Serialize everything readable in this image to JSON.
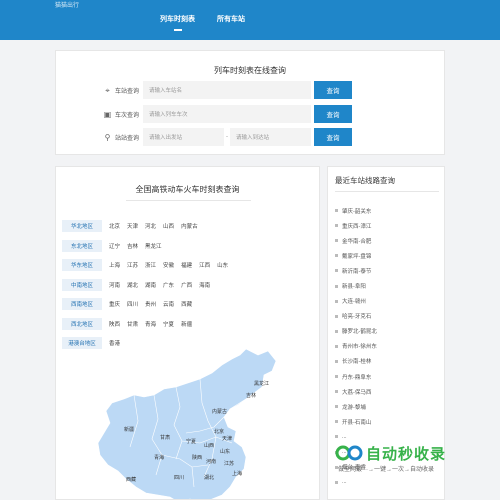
{
  "header": {
    "site_name": "猫猫出行",
    "nav": [
      {
        "label": "列车时刻表",
        "active": true
      },
      {
        "label": "所有车站",
        "active": false
      }
    ]
  },
  "search": {
    "title": "列车时刻表在线查询",
    "station": {
      "label": "车站查询",
      "placeholder": "请输入车站名",
      "button": "查询"
    },
    "train": {
      "label": "车次查询",
      "placeholder": "请输入列车车次",
      "button": "查询"
    },
    "route": {
      "label": "站站查询",
      "from_placeholder": "请输入出发站",
      "separator": "-",
      "to_placeholder": "请输入到达站",
      "button": "查询"
    }
  },
  "regions": {
    "title": "全国高铁动车火车时刻表查询",
    "rows": [
      {
        "name": "华北地区",
        "provinces": [
          "北京",
          "天津",
          "河北",
          "山西",
          "内蒙古"
        ]
      },
      {
        "name": "东北地区",
        "provinces": [
          "辽宁",
          "吉林",
          "黑龙江"
        ]
      },
      {
        "name": "华东地区",
        "provinces": [
          "上海",
          "江苏",
          "浙江",
          "安徽",
          "福建",
          "江西",
          "山东"
        ]
      },
      {
        "name": "中南地区",
        "provinces": [
          "河南",
          "湖北",
          "湖南",
          "广东",
          "广西",
          "海南"
        ]
      },
      {
        "name": "西南地区",
        "provinces": [
          "重庆",
          "四川",
          "贵州",
          "云南",
          "西藏"
        ]
      },
      {
        "name": "西北地区",
        "provinces": [
          "陕西",
          "甘肃",
          "青海",
          "宁夏",
          "新疆"
        ]
      },
      {
        "name": "港澳台地区",
        "provinces": [
          "香港"
        ]
      }
    ],
    "map_labels": {
      "heilongjiang": "黑龙江",
      "jilin": "吉林",
      "neimenggu": "内蒙古",
      "xinjiang": "新疆",
      "gansu": "甘肃",
      "beijing": "北京",
      "tianjin": "天津",
      "ningxia": "宁夏",
      "shanxi": "山西",
      "shandong": "山东",
      "qinghai": "青海",
      "shaanxi": "陕西",
      "henan": "河南",
      "jiangsu": "江苏",
      "shanghai": "上海",
      "xizang": "西藏",
      "sichuan": "四川",
      "hubei": "湖北"
    },
    "map_color": "#bcd9f5"
  },
  "recent": {
    "title": "最近车站线路查询",
    "items": [
      "肇庆-韶关东",
      "重庆西-漳江",
      "金华南-合肥",
      "戴家坪-盘锦",
      "新沂南-泰节",
      "新县-阜阳",
      "大连-赣州",
      "哈亮-牙克石",
      "滕罗北-鹤昆北",
      "青州市-徐州东",
      "长沙南-桂林",
      "丹东-鼎阜东",
      "大荔-保马西",
      "龙游-黎埔",
      "开县-石南山",
      "...",
      "...",
      "烟台-泰睿",
      "..."
    ]
  },
  "watermark": {
    "text": "自动秒收录",
    "sub": "做全网最···→一键→一次→自动收录"
  }
}
